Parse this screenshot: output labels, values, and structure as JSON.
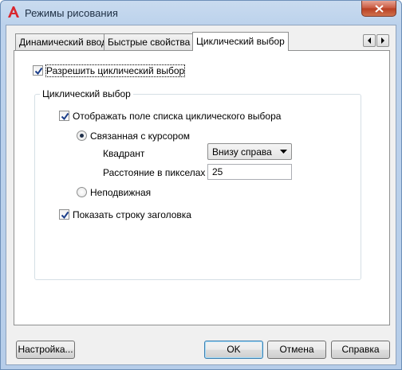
{
  "window": {
    "title": "Режимы рисования"
  },
  "tabs": [
    {
      "label": "Динамический ввод",
      "active": false
    },
    {
      "label": "Быстрые свойства",
      "active": false
    },
    {
      "label": "Циклический выбор",
      "active": true
    }
  ],
  "panel": {
    "enable_cycling": {
      "label": "Разрешить циклический выбор",
      "checked": true
    },
    "group": {
      "title": "Циклический выбор",
      "show_list": {
        "label": "Отображать поле списка циклического выбора",
        "checked": true
      },
      "cursor_dependent": {
        "label": "Связанная с курсором",
        "selected": true
      },
      "quadrant": {
        "label": "Квадрант",
        "value": "Внизу справа"
      },
      "distance": {
        "label": "Расстояние в пикселах",
        "value": "25"
      },
      "static": {
        "label": "Неподвижная",
        "selected": false
      },
      "show_title": {
        "label": "Показать строку заголовка",
        "checked": true
      }
    }
  },
  "buttons": {
    "settings": "Настройка...",
    "ok": "OK",
    "cancel": "Отмена",
    "help": "Справка"
  },
  "colors": {
    "checkmark": "#1b3e8a",
    "close": "#c8573e"
  }
}
